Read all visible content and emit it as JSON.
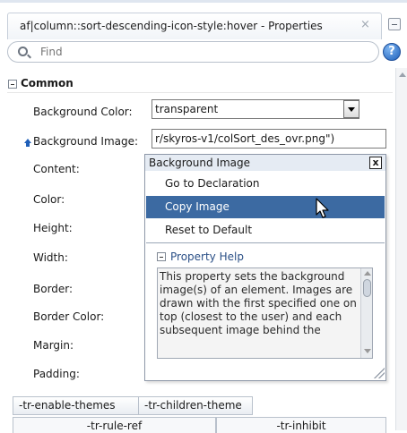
{
  "window": {
    "title": "af|column::sort-descending-icon-style:hover - Properties",
    "close_glyph": "×"
  },
  "search": {
    "placeholder": "Find",
    "value": ""
  },
  "help_glyph": "?",
  "section": {
    "label": "Common"
  },
  "properties": [
    {
      "label": "Background Color:",
      "value": "transparent"
    },
    {
      "label": "Background Image:",
      "value": "r/skyros-v1/colSort_des_ovr.png\")"
    },
    {
      "label": "Content:",
      "value": ""
    },
    {
      "label": "Color:",
      "value": ""
    },
    {
      "label": "Height:",
      "value": ""
    },
    {
      "label": "Width:",
      "value": ""
    },
    {
      "label": "Border:",
      "value": ""
    },
    {
      "label": "Border Color:",
      "value": ""
    },
    {
      "label": "Margin:",
      "value": ""
    },
    {
      "label": "Padding:",
      "value": ""
    }
  ],
  "popup": {
    "title": "Background Image",
    "close_glyph": "x",
    "menu": [
      {
        "label": "Go to Declaration",
        "selected": false
      },
      {
        "label": "Copy Image",
        "selected": true
      },
      {
        "label": "Reset to Default",
        "selected": false
      }
    ],
    "property_help": {
      "label": "Property Help",
      "text": "This property sets the background image(s) of an element. Images are drawn with the first specified one on top (closest to the user) and each subsequent image behind the"
    }
  },
  "bottom_buttons": [
    "-tr-enable-themes",
    "-tr-children-theme"
  ],
  "bottom_tabs": [
    "-tr-rule-ref",
    "-tr-inhibit"
  ],
  "colors": {
    "selection": "#3c6aa2",
    "header_bg": "#e5ebf3",
    "help_link": "#2a4f86"
  }
}
